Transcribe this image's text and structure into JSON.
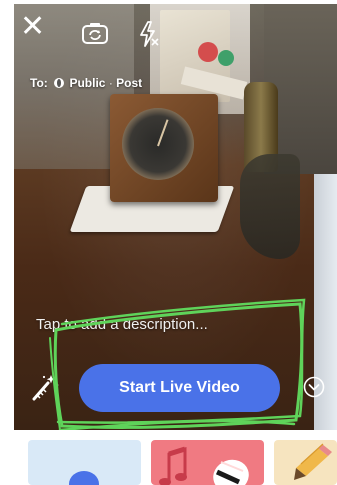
{
  "top_bar": {
    "close_icon": "close-icon",
    "flip_icon": "camera-flip-icon",
    "flash_icon": "flash-off-icon"
  },
  "audience": {
    "prefix": "To:",
    "privacy": "Public",
    "separator": "·",
    "type": "Post",
    "icon": "globe-icon"
  },
  "description_placeholder": "Tap to add a description...",
  "start_button_label": "Start Live Video",
  "effects_icon": "magic-wand-icon",
  "more_icon": "chevron-down-circle-icon",
  "colors": {
    "accent_button": "#4a72e8",
    "annotation_marker": "#5fd35a",
    "tile_blue": "#d9e9f7",
    "tile_pink": "#f07a82",
    "tile_cream": "#f6e4bf"
  },
  "tray": {
    "tiles": [
      {
        "icon": "avatar-icon"
      },
      {
        "icon": "music-note-icon"
      },
      {
        "icon": "pencil-icon"
      }
    ]
  }
}
